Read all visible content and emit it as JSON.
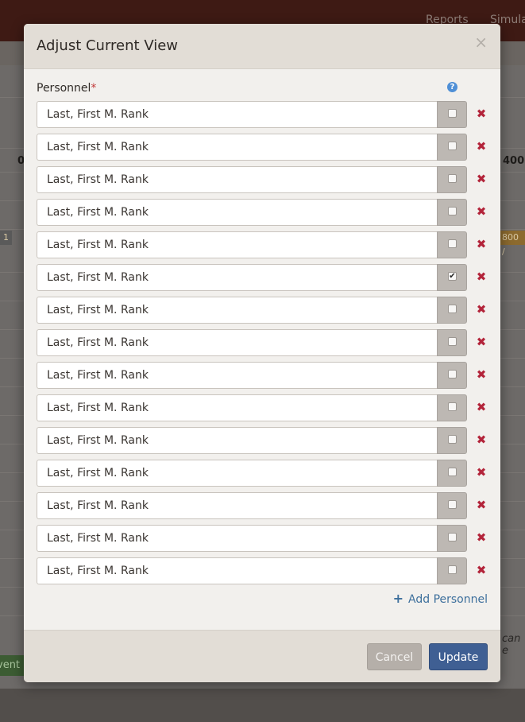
{
  "background": {
    "nav_reports": "Reports",
    "nav_simula": "Simula",
    "col_start": "0",
    "col_end": "400",
    "chip_left": "1",
    "chip_right": "800 /",
    "side_text": "can e",
    "green_button": "vent"
  },
  "modal": {
    "title": "Adjust Current View",
    "close_symbol": "×",
    "field_label": "Personnel",
    "required_mark": "*",
    "help_symbol": "?",
    "add_symbol": "+",
    "add_label": "Add Personnel",
    "personnel": [
      {
        "name": "Last, First M. Rank",
        "checked": false
      },
      {
        "name": "Last, First M. Rank",
        "checked": false
      },
      {
        "name": "Last, First M. Rank",
        "checked": false
      },
      {
        "name": "Last, First M. Rank",
        "checked": false
      },
      {
        "name": "Last, First M. Rank",
        "checked": false
      },
      {
        "name": "Last, First M. Rank",
        "checked": true
      },
      {
        "name": "Last, First M. Rank",
        "checked": false
      },
      {
        "name": "Last, First M. Rank",
        "checked": false
      },
      {
        "name": "Last, First M. Rank",
        "checked": false
      },
      {
        "name": "Last, First M. Rank",
        "checked": false
      },
      {
        "name": "Last, First M. Rank",
        "checked": false
      },
      {
        "name": "Last, First M. Rank",
        "checked": false
      },
      {
        "name": "Last, First M. Rank",
        "checked": false
      },
      {
        "name": "Last, First M. Rank",
        "checked": false
      },
      {
        "name": "Last, First M. Rank",
        "checked": false
      }
    ],
    "check_mark": "✔",
    "remove_symbol": "✖",
    "cancel_label": "Cancel",
    "update_label": "Update"
  },
  "colors": {
    "primary": "#3f5f93",
    "danger": "#b3243a",
    "link": "#3d6f9c"
  }
}
